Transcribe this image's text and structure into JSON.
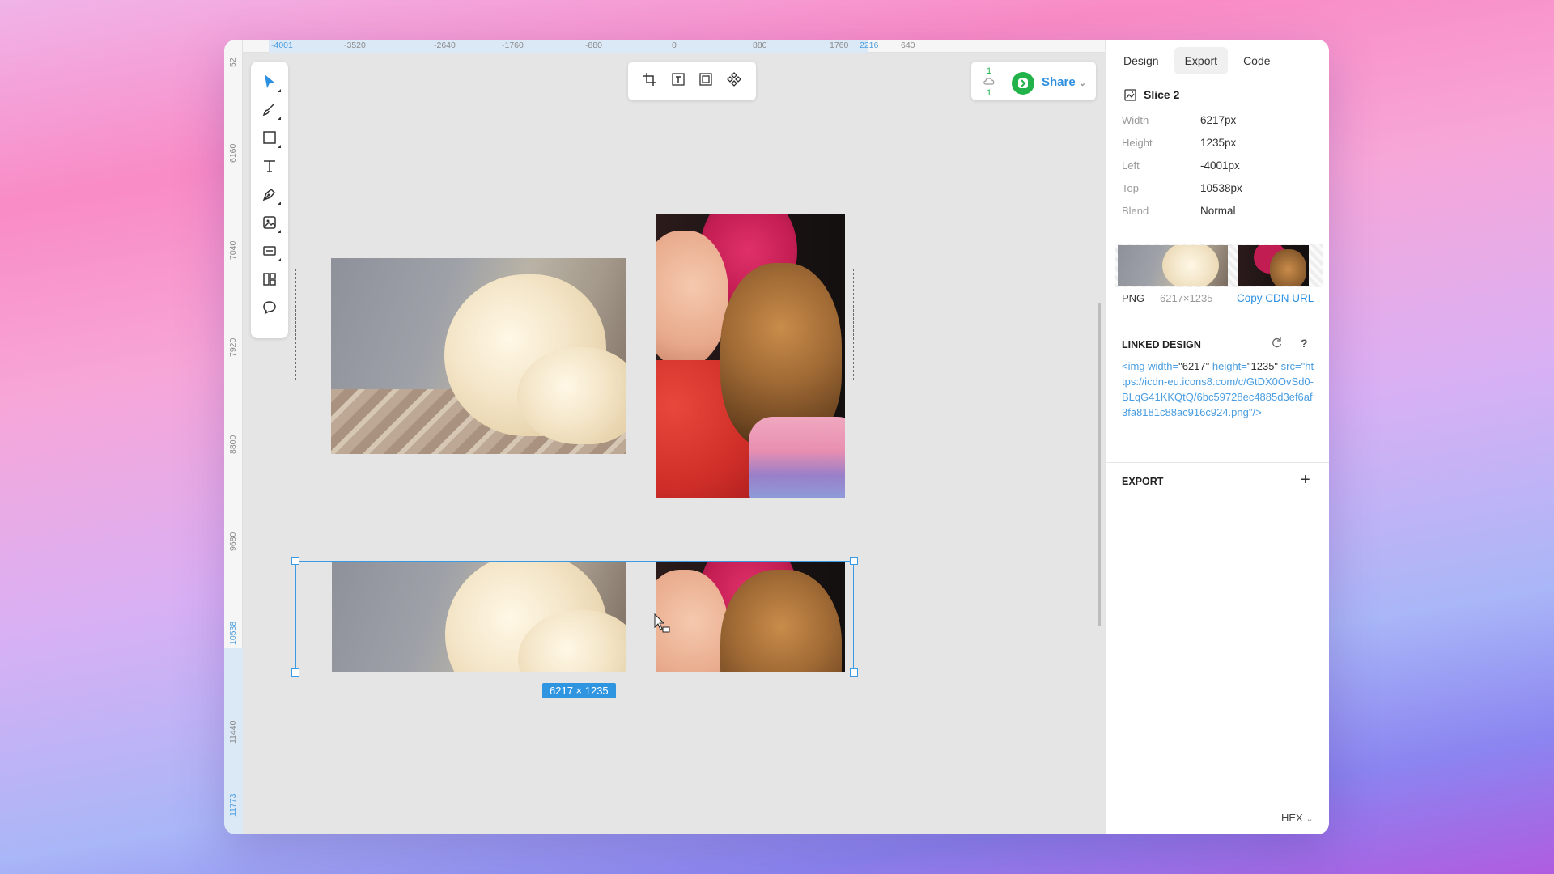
{
  "ruler_top": {
    "ticks": [
      "-4001",
      "-3520",
      "-2640",
      "-1760",
      "-880",
      "0",
      "880",
      "1760",
      "2216",
      "640"
    ]
  },
  "ruler_left": {
    "ticks": [
      "52",
      "6160",
      "7040",
      "7920",
      "8800",
      "9680",
      "10538",
      "11440",
      "11773"
    ]
  },
  "tools": {
    "select_icon": "arrow-cursor-icon",
    "brush_icon": "brush-icon",
    "rect_icon": "rectangle-icon",
    "text_icon": "text-icon",
    "pen_icon": "pen-icon",
    "image_icon": "image-icon",
    "frame_icon": "frame-icon",
    "component_icon": "component-icon",
    "comment_icon": "comment-icon"
  },
  "header": {
    "cloud_count_top": "1",
    "cloud_count_bottom": "1",
    "share_label": "Share"
  },
  "canvas": {
    "selection_dims": "6217 × 1235"
  },
  "panel": {
    "tabs": [
      "Design",
      "Export",
      "Code"
    ],
    "active_tab": "Export",
    "slice_title": "Slice 2",
    "props": [
      {
        "label": "Width",
        "value": "6217px"
      },
      {
        "label": "Height",
        "value": "1235px"
      },
      {
        "label": "Left",
        "value": "-4001px"
      },
      {
        "label": "Top",
        "value": "10538px"
      },
      {
        "label": "Blend",
        "value": "Normal"
      }
    ],
    "format": "PNG",
    "format_dims": "6217×1235",
    "copy_cdn": "Copy CDN URL",
    "linked_design_title": "LINKED DESIGN",
    "code": {
      "tag_open": "<img ",
      "width_attr": "width=",
      "width_val": "\"6217\"",
      "height_attr": " height=",
      "height_val": "\"1235\"",
      "src_attr": " src=",
      "src_val": "\"https://icdn-eu.icons8.com/c/GtDX0OvSd0-BLqG41KKQtQ/6bc59728ec4885d3ef6af3fa8181c88ac916c924.png\"",
      "tag_close": "/>"
    },
    "export_title": "EXPORT",
    "color_mode": "HEX"
  }
}
